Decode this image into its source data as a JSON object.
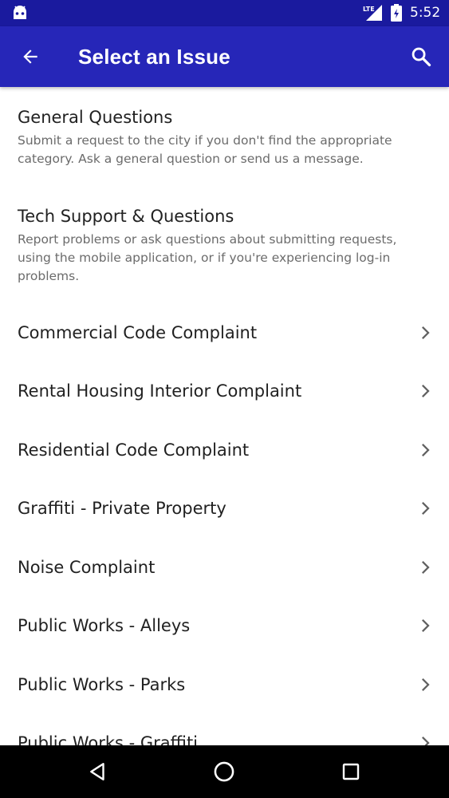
{
  "status_bar": {
    "network": "LTE",
    "time": "5:52",
    "icons": [
      "android-icon",
      "lte-signal-icon",
      "battery-icon"
    ]
  },
  "app_bar": {
    "title": "Select an Issue",
    "back_icon": "arrow-left-icon",
    "search_icon": "search-icon",
    "color": "#2626b8"
  },
  "list": {
    "info_items": [
      {
        "heading": "General Questions",
        "description": "Submit a request to the city if you don't find the appropriate category. Ask a general question or send us a message."
      },
      {
        "heading": "Tech Support & Questions",
        "description": "Report problems or ask questions about submitting requests, using the mobile application, or if you're experiencing log-in problems."
      }
    ],
    "nav_items": [
      {
        "label": "Commercial Code Complaint"
      },
      {
        "label": "Rental Housing Interior Complaint"
      },
      {
        "label": "Residential Code Complaint"
      },
      {
        "label": "Graffiti - Private Property"
      },
      {
        "label": "Noise Complaint"
      },
      {
        "label": "Public Works - Alleys"
      },
      {
        "label": "Public Works - Parks"
      },
      {
        "label": "Public Works - Graffiti"
      }
    ]
  },
  "nav_bar": {
    "buttons": [
      "back-triangle-icon",
      "home-circle-icon",
      "recents-square-icon"
    ]
  }
}
